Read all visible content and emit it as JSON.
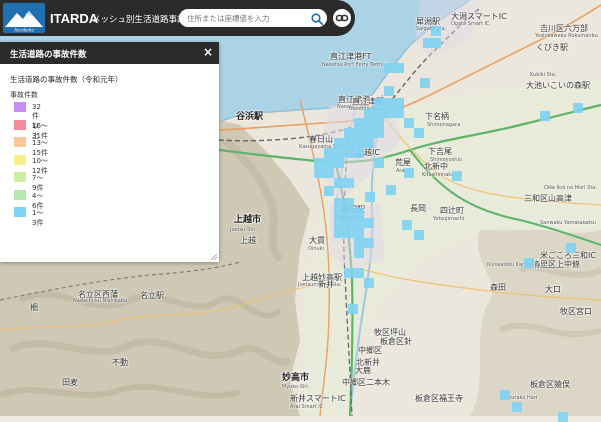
{
  "header": {
    "logo_text": "Accidents",
    "brand": "ITARDA",
    "title": "メッシュ別生活道路事故件数",
    "search_placeholder": "住所または座標値を入力",
    "search_icon": "search-icon",
    "link_icon": "link-icon"
  },
  "panel": {
    "title": "生活道路の事故件数",
    "close": "×",
    "subtitle": "生活道路の事故件数（令和元年）",
    "unit": "事故件数",
    "legend": [
      {
        "label": "32件以上",
        "color": "#c98cf0"
      },
      {
        "label": "16〜31件",
        "color": "#f28b9a"
      },
      {
        "label": "13〜15件",
        "color": "#f6c89a"
      },
      {
        "label": "10〜12件",
        "color": "#f5f08c"
      },
      {
        "label": "7〜9件",
        "color": "#c9ee9d"
      },
      {
        "label": "4〜6件",
        "color": "#b8e6b0"
      },
      {
        "label": "1〜3件",
        "color": "#7ed3f2"
      }
    ]
  },
  "map": {
    "labels": [
      {
        "t": "谷浜駅",
        "k": "big"
      },
      {
        "t": "直江津港FT"
      },
      {
        "t": "Naoetsu Port Ferry Terminal"
      },
      {
        "t": "直江津港"
      },
      {
        "t": "Naoetsu Port"
      },
      {
        "t": "直江津駅"
      },
      {
        "t": "Naoetsu Sta."
      },
      {
        "t": "春日山"
      },
      {
        "t": "Kasugayama Sta."
      },
      {
        "t": "上越IC"
      },
      {
        "t": "上越市",
        "k": "big"
      },
      {
        "t": "Joetsu-Shi"
      },
      {
        "t": "高田駅"
      },
      {
        "t": "Takada Sta."
      },
      {
        "t": "大貫"
      },
      {
        "t": "Oinuki"
      },
      {
        "t": "上越妙高駅"
      },
      {
        "t": "Joetsumyoko Sta."
      },
      {
        "t": "名立区西蒲"
      },
      {
        "t": "Nadachi-ku Nishikaba"
      },
      {
        "t": "柵"
      },
      {
        "t": "田麦"
      },
      {
        "t": "妙高市",
        "k": "big"
      },
      {
        "t": "Myoko-Shi"
      },
      {
        "t": "大鹿"
      },
      {
        "t": "長岡"
      },
      {
        "t": "四辻町"
      },
      {
        "t": "Yotsujimachi"
      },
      {
        "t": "荒屋"
      },
      {
        "t": "Araya"
      },
      {
        "t": "北新中"
      },
      {
        "t": "Kitashinnaka"
      },
      {
        "t": "下吉尾"
      },
      {
        "t": "Shimoyoshio"
      },
      {
        "t": "下名柄"
      },
      {
        "t": "Shimonagara"
      },
      {
        "t": "犀潟駅"
      },
      {
        "t": "Saigata Sta."
      },
      {
        "t": "大潟スマートIC"
      },
      {
        "t": "Ogata Smart IC"
      },
      {
        "t": "吉川区六万部"
      },
      {
        "t": "Yoshikawaku Rokumanbu"
      },
      {
        "t": "くびき駅"
      },
      {
        "t": "Kubiki Sta."
      },
      {
        "t": "大池いこいの森駅"
      },
      {
        "t": "Oike Ikoi no Mori Sta."
      },
      {
        "t": "三和区山高津"
      },
      {
        "t": "Sanwaku Yamatakatsu"
      },
      {
        "t": "米ごころ三和IC"
      },
      {
        "t": "清里区上中條"
      },
      {
        "t": "Kiyosatoku Kaminakajo"
      },
      {
        "t": "森田"
      },
      {
        "t": "大口"
      },
      {
        "t": "牧区宮口"
      },
      {
        "t": "牧区坪山"
      },
      {
        "t": "板倉区針"
      },
      {
        "t": "Itakuraku Hari"
      },
      {
        "t": "板倉区福王寺"
      },
      {
        "t": "板倉区猿俣"
      },
      {
        "t": "中郷区二本木"
      },
      {
        "t": "新井スマートIC"
      },
      {
        "t": "Arai Smart IC"
      },
      {
        "t": "中郷区"
      },
      {
        "t": "北新井"
      },
      {
        "t": "新井"
      },
      {
        "t": "上越"
      },
      {
        "t": "不動"
      },
      {
        "t": "名立駅"
      }
    ]
  }
}
